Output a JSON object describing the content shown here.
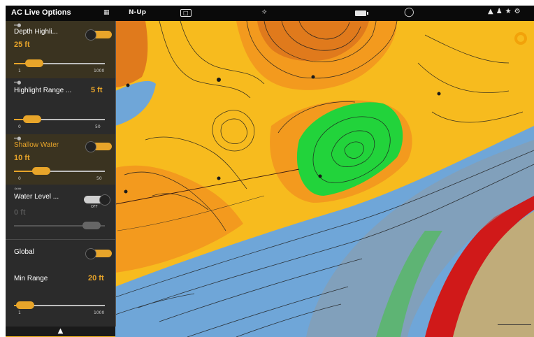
{
  "topbar": {
    "title": "AC Live Options",
    "items": [
      "N-Up",
      "□"
    ]
  },
  "panel": {
    "depth_highlight": {
      "label": "Depth Highli...",
      "value": "25 ft",
      "toggle": "on",
      "min_tick": "1",
      "max_tick": "1000",
      "level": 0.12
    },
    "highlight_range": {
      "label": "Highlight Range ...",
      "value": "5 ft",
      "min_tick": "0",
      "max_tick": "50",
      "level": 0.1
    },
    "shallow_water": {
      "label": "Shallow Water",
      "value": "10 ft",
      "toggle": "on",
      "min_tick": "0",
      "max_tick": "50",
      "level": 0.2
    },
    "water_level": {
      "label": "Water Level ...",
      "value": "0 ft",
      "toggle": "off",
      "state_text": "OFF",
      "level": 0.75
    },
    "global": {
      "label": "Global",
      "toggle": "on"
    },
    "min_range": {
      "label": "Min Range",
      "value": "20 ft",
      "min_tick": "1",
      "max_tick": "1000",
      "level": 0.02
    },
    "collapse_glyph": "▲"
  },
  "colors": {
    "accent": "#e8a52a",
    "shallow_yellow": "#f7bb1e",
    "mid_orange": "#f39a1e",
    "deep_orange": "#e07a1c",
    "highlight_green": "#22d33b",
    "water_blue": "#6fa6d8",
    "drop_red": "#d01919",
    "land_tan": "#c0ac7a"
  }
}
